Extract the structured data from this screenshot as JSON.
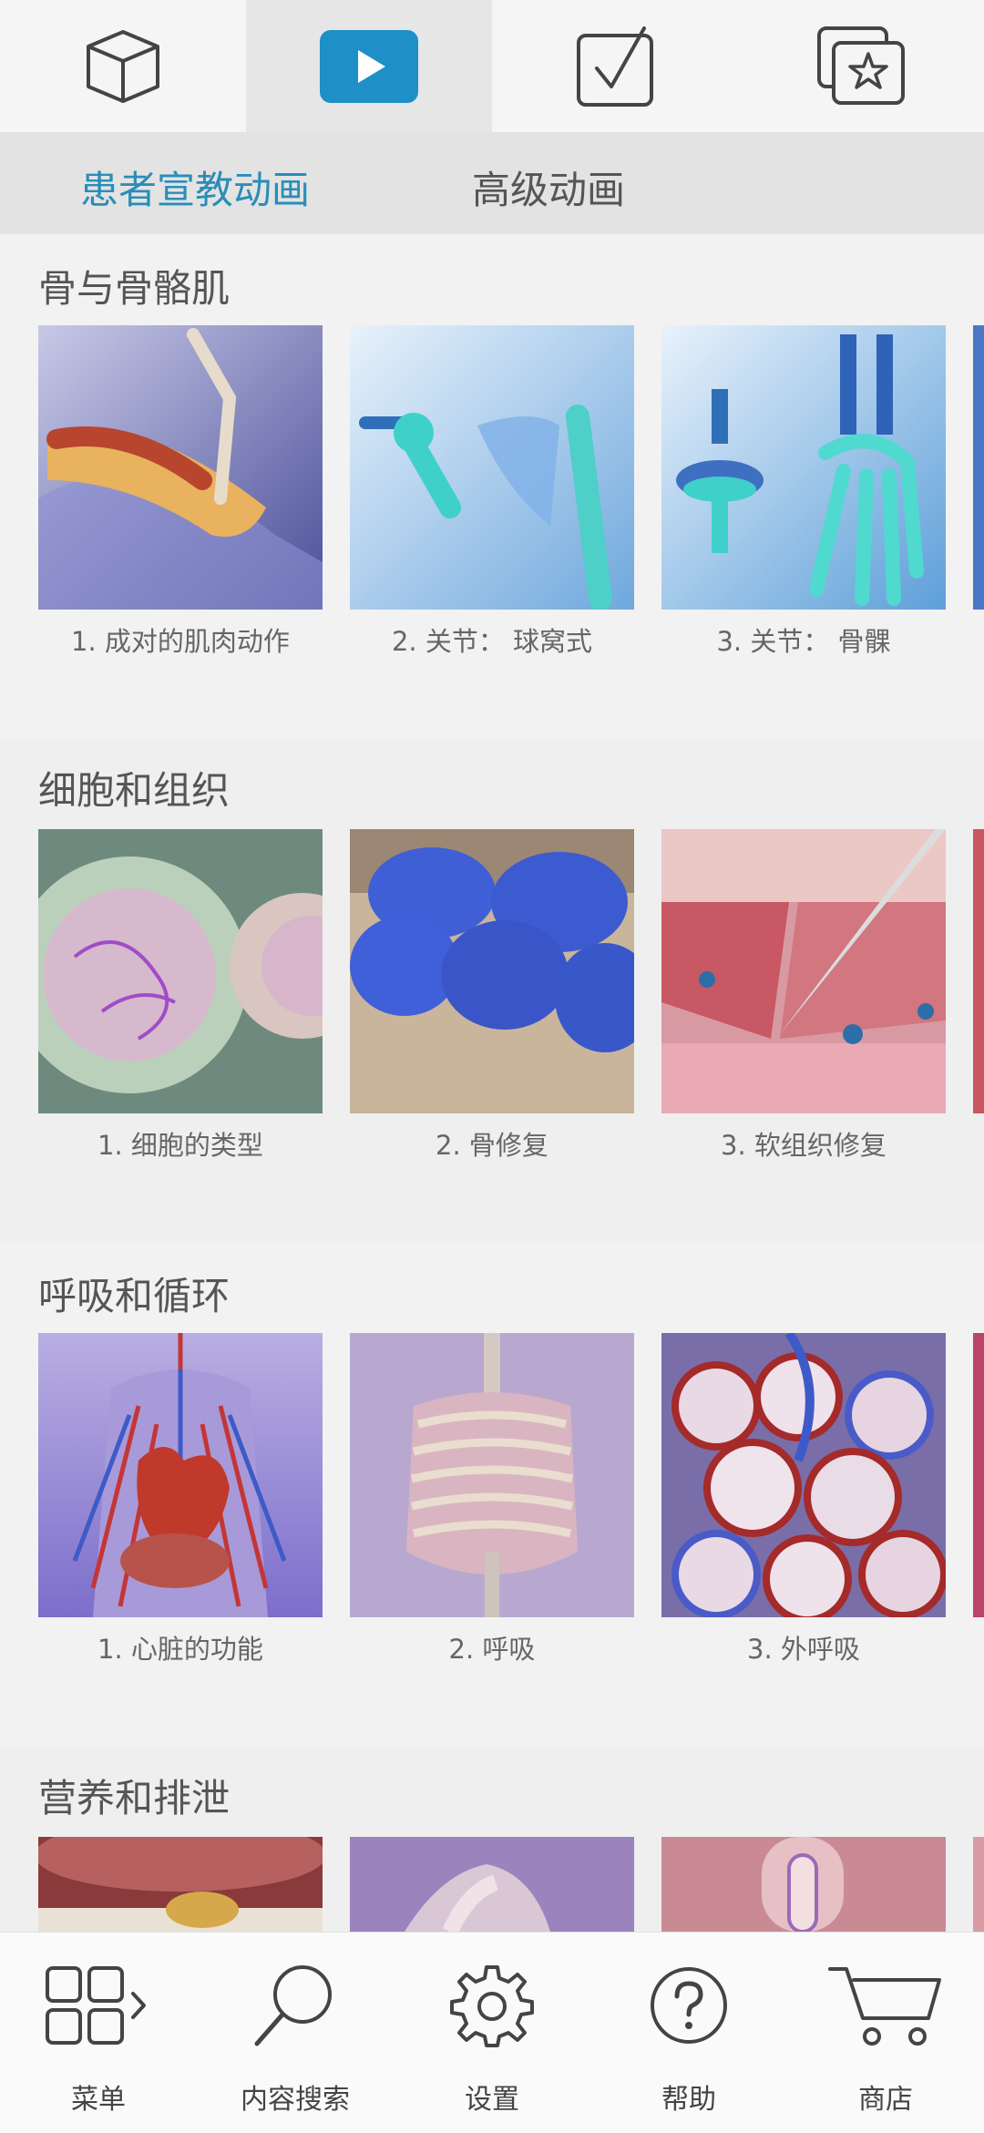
{
  "top_tabs": [
    {
      "icon": "cube-icon"
    },
    {
      "icon": "play-icon",
      "active": true
    },
    {
      "icon": "checkbox-icon"
    },
    {
      "icon": "favorites-icon"
    }
  ],
  "sub_tabs": [
    {
      "label": "患者宣教动画",
      "active": true
    },
    {
      "label": "高级动画"
    }
  ],
  "sections": [
    {
      "title": "骨与骨骼肌",
      "items": [
        {
          "caption": "1.  成对的肌肉动作"
        },
        {
          "caption": "2.  关节：  球窝式"
        },
        {
          "caption": "3.  关节：  骨髁"
        }
      ]
    },
    {
      "title": "细胞和组织",
      "items": [
        {
          "caption": "1.  细胞的类型"
        },
        {
          "caption": "2.  骨修复"
        },
        {
          "caption": "3.  软组织修复"
        }
      ]
    },
    {
      "title": "呼吸和循环",
      "items": [
        {
          "caption": "1.  心脏的功能"
        },
        {
          "caption": "2.  呼吸"
        },
        {
          "caption": "3.  外呼吸"
        }
      ]
    },
    {
      "title": "营养和排泄",
      "items": [
        {
          "caption": ""
        },
        {
          "caption": ""
        },
        {
          "caption": ""
        }
      ]
    }
  ],
  "bottom_nav": [
    {
      "label": "菜单",
      "icon": "menu-grid-icon"
    },
    {
      "label": "内容搜索",
      "icon": "search-icon"
    },
    {
      "label": "设置",
      "icon": "gear-icon"
    },
    {
      "label": "帮助",
      "icon": "help-icon"
    },
    {
      "label": "商店",
      "icon": "cart-icon"
    }
  ],
  "colors": {
    "accent": "#2a8db8",
    "play_button": "#1e8fc7"
  }
}
